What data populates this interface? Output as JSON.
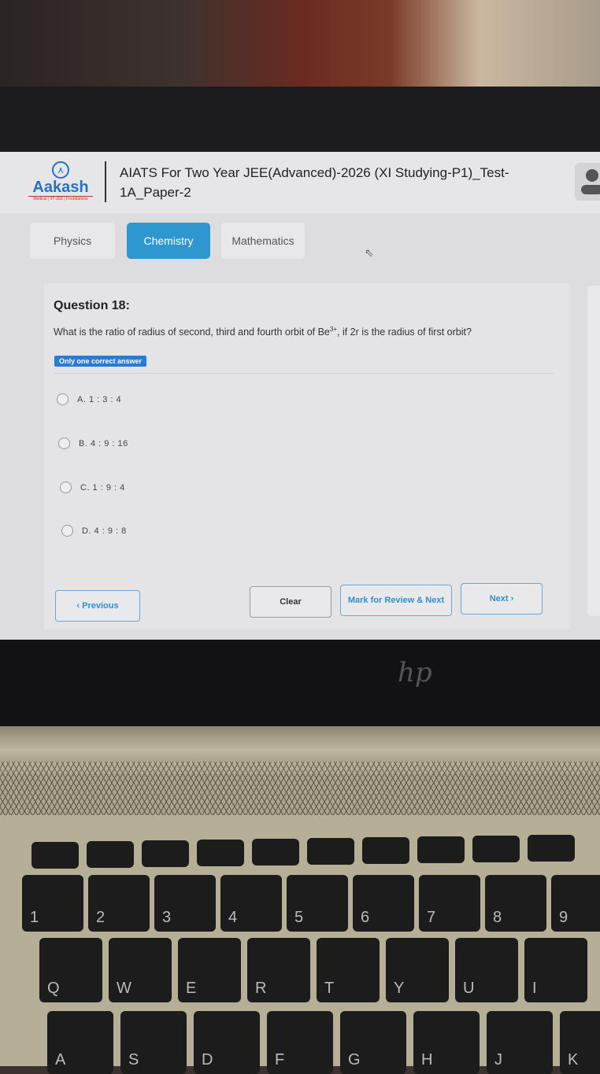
{
  "header": {
    "logo_text": "Aakash",
    "logo_sub": "Medical | IIT-JEE | Foundations",
    "title": "AIATS For Two Year JEE(Advanced)-2026 (XI Studying-P1)_Test-1A_Paper-2"
  },
  "tabs": [
    {
      "label": "Physics",
      "active": false
    },
    {
      "label": "Chemistry",
      "active": true
    },
    {
      "label": "Mathematics",
      "active": false
    }
  ],
  "question": {
    "title": "Question 18:",
    "text_before": "What is the ratio of radius of second, third and fourth orbit of Be",
    "superscript": "3+",
    "text_after": ", if 2r is the radius of first orbit?",
    "type_badge": "Only one correct answer",
    "options": [
      {
        "label": "A. 1 : 3 : 4",
        "selected": false
      },
      {
        "label": "B. 4 : 9 : 16",
        "selected": false
      },
      {
        "label": "C. 1 : 9 : 4",
        "selected": false
      },
      {
        "label": "D. 4 : 9 : 8",
        "selected": false
      }
    ]
  },
  "buttons": {
    "previous": "‹  Previous",
    "clear": "Clear",
    "mark_review": "Mark for Review & Next",
    "next": "Next  ›"
  },
  "colors": {
    "accent": "#2f97cf",
    "badge": "#2a7bd6",
    "brand": "#2b6fc0"
  },
  "laptop": {
    "brand_logo": "hp",
    "keys_row1": [
      "!\n1",
      "@\n2",
      "#\n3",
      "$\n4",
      "%\n5",
      "^\n6",
      "&\n7",
      "*\n8",
      "(\n9"
    ],
    "keys_row2": [
      "Q",
      "W",
      "E",
      "R",
      "T",
      "Y",
      "U",
      "I"
    ],
    "keys_row3": [
      "A",
      "S",
      "D",
      "F",
      "G",
      "H",
      "J",
      "K"
    ]
  }
}
